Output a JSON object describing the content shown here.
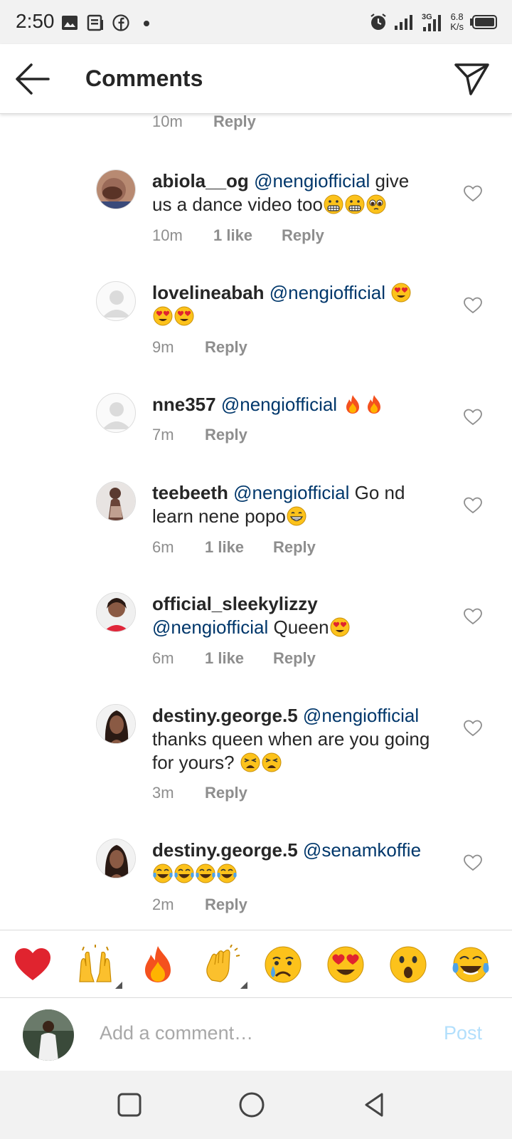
{
  "status_bar": {
    "time": "2:50",
    "speed_value": "6.8",
    "speed_unit": "K/s"
  },
  "header": {
    "title": "Comments"
  },
  "partial_comment": {
    "time": "10m",
    "reply": "Reply"
  },
  "comments": [
    {
      "username": "abiola__og",
      "mention": "@nengiofficial",
      "text": " give us a dance video too",
      "emojis": [
        "grimace",
        "grimace",
        "pleading"
      ],
      "time": "10m",
      "likes": "1 like",
      "reply": "Reply"
    },
    {
      "username": "lovelineabah",
      "mention": "@nengiofficial",
      "text": " ",
      "emojis": [
        "heart-eyes",
        "heart-eyes",
        "heart-eyes"
      ],
      "time": "9m",
      "likes": "",
      "reply": "Reply"
    },
    {
      "username": "nne357",
      "mention": "@nengiofficial",
      "text": " ",
      "emojis": [
        "fire",
        "fire"
      ],
      "time": "7m",
      "likes": "",
      "reply": "Reply"
    },
    {
      "username": "teebeeth",
      "mention": "@nengiofficial",
      "text": " Go nd learn nene popo",
      "emojis": [
        "grin"
      ],
      "time": "6m",
      "likes": "1 like",
      "reply": "Reply"
    },
    {
      "username": "official_sleekylizzy",
      "mention": "@nengiofficial",
      "text": " Queen",
      "emojis": [
        "heart-eyes"
      ],
      "time": "6m",
      "likes": "1 like",
      "reply": "Reply"
    },
    {
      "username": "destiny.george.5",
      "mention": "@nengiofficial",
      "text": " thanks queen when are you going for yours? ",
      "emojis": [
        "weary",
        "weary"
      ],
      "time": "3m",
      "likes": "",
      "reply": "Reply"
    },
    {
      "username": "destiny.george.5",
      "mention": "@senamkoffie",
      "text": " ",
      "emojis": [
        "joy",
        "joy",
        "joy",
        "joy"
      ],
      "time": "2m",
      "likes": "",
      "reply": "Reply"
    }
  ],
  "reactions": [
    "red-heart",
    "raised-hands",
    "fire",
    "clapping-hands",
    "crying-face",
    "heart-eyes",
    "astonished-face",
    "tears-of-joy"
  ],
  "input": {
    "placeholder": "Add a comment…",
    "post_label": "Post"
  },
  "colors": {
    "mention": "#00376b",
    "meta": "#8e8e8e",
    "post_disabled": "#b2dffc",
    "heart_red": "#e0242f"
  }
}
